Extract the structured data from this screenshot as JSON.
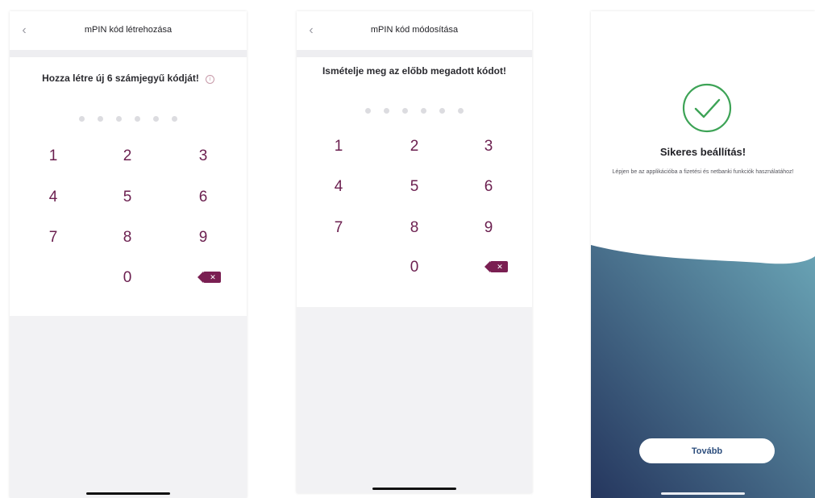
{
  "screens": [
    {
      "title": "mPIN kód létrehozása",
      "prompt": "Hozza létre új 6 számjegyű kódját!",
      "info_icon": "ⓘ",
      "keys": [
        "1",
        "2",
        "3",
        "4",
        "5",
        "6",
        "7",
        "8",
        "9",
        "0"
      ],
      "delete_icon": "backspace-icon"
    },
    {
      "title": "mPIN kód módosítása",
      "prompt": "Ismételje meg az előbb megadott kódot!",
      "keys": [
        "1",
        "2",
        "3",
        "4",
        "5",
        "6",
        "7",
        "8",
        "9",
        "0"
      ],
      "delete_icon": "backspace-icon"
    },
    {
      "title": "Sikeres beállítás!",
      "body": "Lépjen be az applikációba a fizetési és netbanki funkciók használatához!",
      "button": "Tovább",
      "icon": "checkmark-circle-icon"
    }
  ],
  "icons": {
    "back": "‹",
    "delete_x": "✕"
  },
  "colors": {
    "accent": "#6b1f4f",
    "success_green": "#3da356",
    "gradient_dark": "#25365e",
    "gradient_light": "#6aa5b6"
  }
}
